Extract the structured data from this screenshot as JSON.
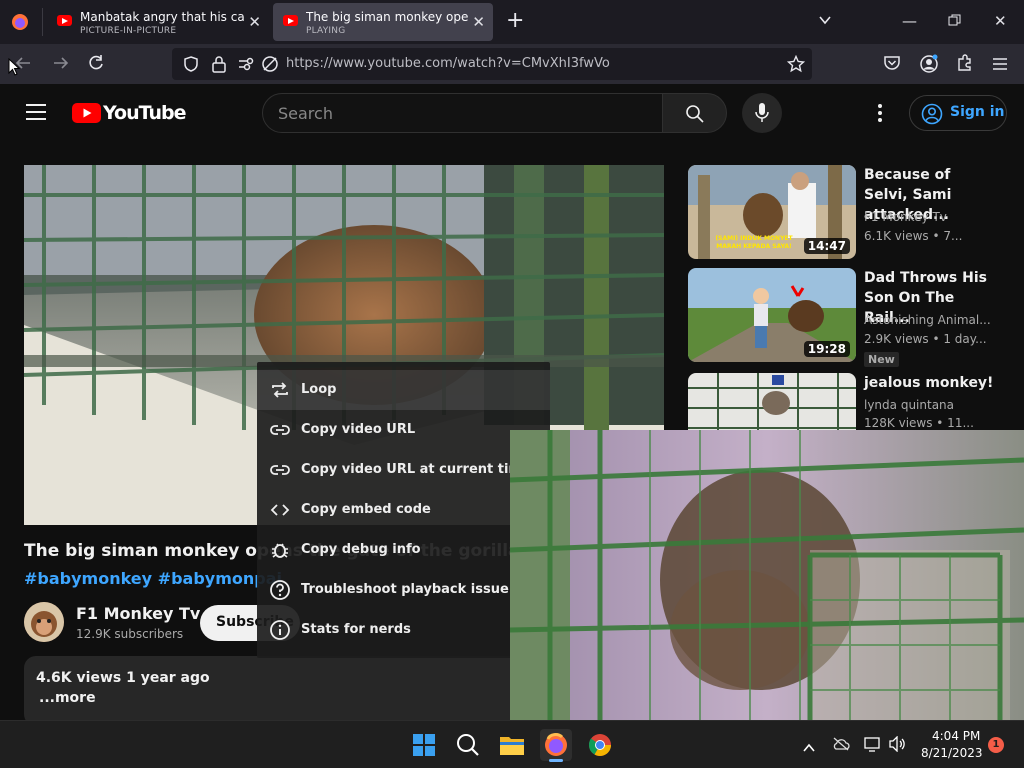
{
  "browser": {
    "tabs": [
      {
        "title": "Manbatak angry that his cage is",
        "status": "PICTURE-IN-PICTURE"
      },
      {
        "title": "The big siman monkey opens the",
        "status": "PLAYING"
      }
    ],
    "url": "https://www.youtube.com/watch?v=CMvXhI3fwVo"
  },
  "youtube": {
    "logo_text": "YouTube",
    "search_placeholder": "Search",
    "sign_in": "Sign in",
    "video": {
      "title": "The big siman monkey opens the gate of the gorilla! #baruk #",
      "tags": "#babymonkey #babymonpai",
      "channel": "F1 Monkey Tv",
      "subscribers": "12.9K subscribers",
      "subscribe": "Subscribe",
      "views_date": "4.6K views  1 year ago",
      "more": "...more"
    },
    "recommendations": [
      {
        "title": "Because of Selvi, Sami attacked...",
        "channel": "F1 Monkey Tv",
        "meta": "6.1K views  • 7...",
        "duration": "14:47",
        "thumb_caption": "(SAMI) INDUK MONYET MARAH KEPADA SAYA!"
      },
      {
        "title": "Dad Throws His Son On The Rail...",
        "channel": "Astonishing Animal...",
        "meta": "2.9K views  • 1 day...",
        "duration": "19:28",
        "badge": "New"
      },
      {
        "title": "jealous monkey!",
        "channel": "lynda quintana",
        "meta": "128K views  • 11..."
      }
    ]
  },
  "context_menu": {
    "items": [
      {
        "label": "Loop",
        "icon": "loop-icon"
      },
      {
        "label": "Copy video URL",
        "icon": "link-icon"
      },
      {
        "label": "Copy video URL at current time",
        "icon": "link-icon"
      },
      {
        "label": "Copy embed code",
        "icon": "code-icon"
      },
      {
        "label": "Copy debug info",
        "icon": "bug-icon"
      },
      {
        "label": "Troubleshoot playback issue",
        "icon": "help-icon"
      },
      {
        "label": "Stats for nerds",
        "icon": "info-icon"
      }
    ]
  },
  "taskbar": {
    "time": "4:04 PM",
    "date": "8/21/2023",
    "notifications": "1"
  }
}
